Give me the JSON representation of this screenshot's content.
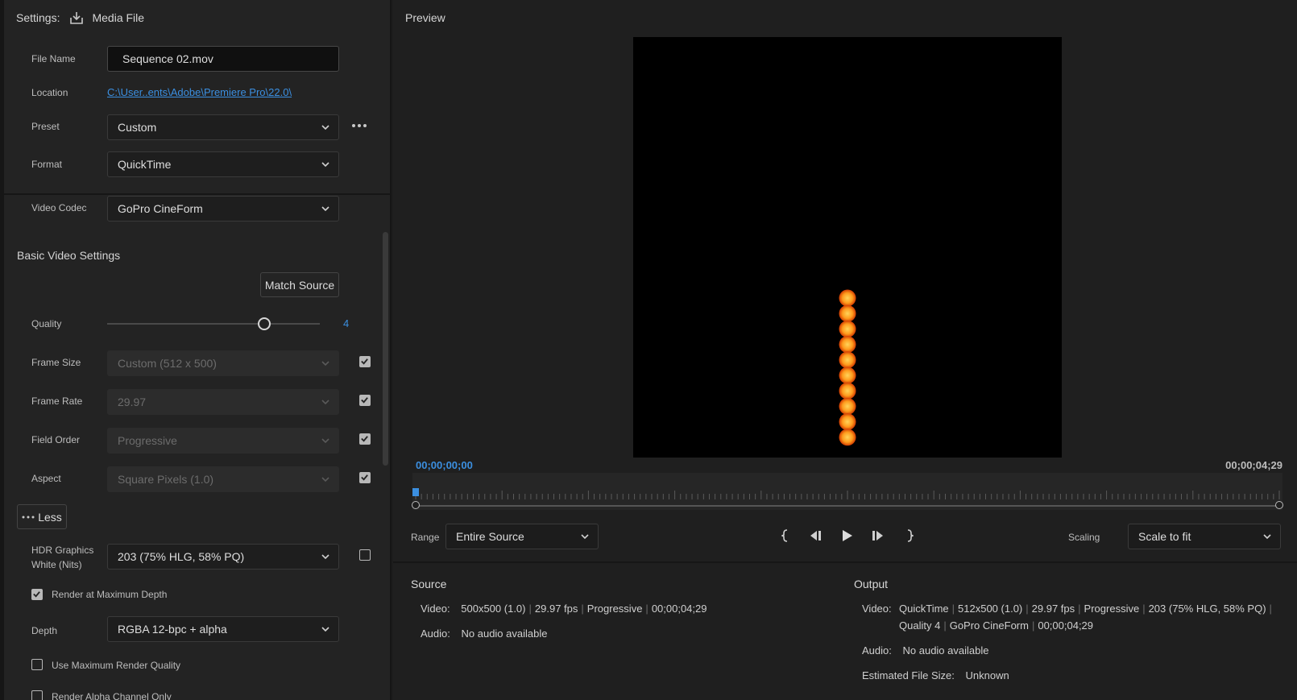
{
  "settings": {
    "title": "Settings:",
    "media_file": "Media File",
    "file_name_label": "File Name",
    "file_name": "Sequence 02.mov",
    "location_label": "Location",
    "location": "C:\\User..ents\\Adobe\\Premiere Pro\\22.0\\",
    "preset_label": "Preset",
    "preset": "Custom",
    "format_label": "Format",
    "format": "QuickTime",
    "video_codec_label": "Video Codec",
    "video_codec": "GoPro CineForm",
    "basic_video_title": "Basic Video Settings",
    "match_source": "Match Source",
    "quality_label": "Quality",
    "quality_value": "4",
    "quality_fraction": 0.74,
    "frame_size_label": "Frame Size",
    "frame_size": "Custom (512 x 500)",
    "frame_rate_label": "Frame Rate",
    "frame_rate": "29.97",
    "field_order_label": "Field Order",
    "field_order": "Progressive",
    "aspect_label": "Aspect",
    "aspect": "Square Pixels (1.0)",
    "less_button": "Less",
    "hdr_label_1": "HDR Graphics",
    "hdr_label_2": "White (Nits)",
    "hdr_value": "203 (75% HLG, 58% PQ)",
    "render_max_depth": "Render at Maximum Depth",
    "depth_label": "Depth",
    "depth": "RGBA 12-bpc + alpha",
    "use_max_quality": "Use Maximum Render Quality",
    "render_alpha_only": "Render Alpha Channel Only"
  },
  "preview": {
    "title": "Preview",
    "timecode_start": "00;00;00;00",
    "timecode_end": "00;00;04;29",
    "range_label": "Range",
    "range": "Entire Source",
    "scaling_label": "Scaling",
    "scaling": "Scale to fit"
  },
  "source": {
    "title": "Source",
    "video_label": "Video:",
    "video_parts": [
      "500x500 (1.0)",
      "29.97 fps",
      "Progressive",
      "00;00;04;29"
    ],
    "audio_label": "Audio:",
    "audio": "No audio available"
  },
  "output": {
    "title": "Output",
    "video_label": "Video:",
    "video_line1": [
      "QuickTime",
      "512x500 (1.0)",
      "29.97 fps",
      "Progressive",
      "203 (75% HLG, 58% PQ)"
    ],
    "video_line2": [
      "Quality 4",
      "GoPro CineForm",
      "00;00;04;29"
    ],
    "audio_label": "Audio:",
    "audio": "No audio available",
    "size_label": "Estimated File Size:",
    "size": "Unknown"
  },
  "colors": {
    "accent": "#3b8fe0",
    "glow": "#ff9b1c"
  }
}
